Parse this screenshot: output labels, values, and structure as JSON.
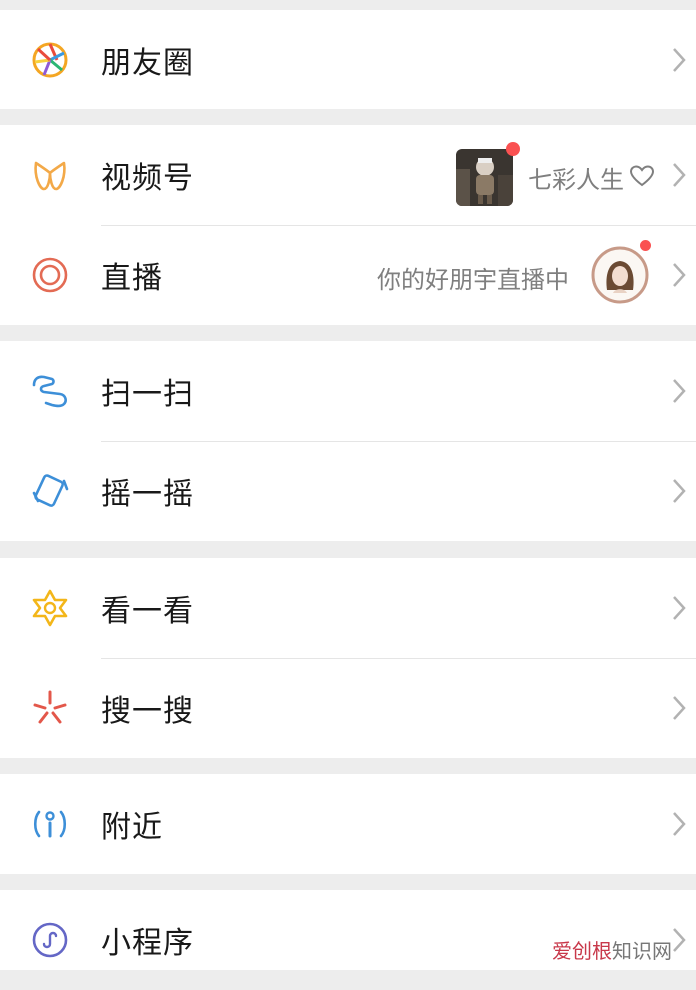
{
  "menu": {
    "moments": "朋友圈",
    "channels": "视频号",
    "channels_note": "七彩人生",
    "live": "直播",
    "live_note": "你的好朋宇直播中",
    "scan": "扫一扫",
    "shake": "摇一摇",
    "top_stories": "看一看",
    "search": "搜一搜",
    "nearby": "附近",
    "mini_programs": "小程序"
  },
  "watermark": {
    "part1": "爱创根",
    "part2": "知识网"
  },
  "colors": {
    "page_bg": "#ededed",
    "card_bg": "#ffffff",
    "divider": "#e5e5e5",
    "red_dot": "#fa5151",
    "secondary_text": "#7f7f7f"
  }
}
